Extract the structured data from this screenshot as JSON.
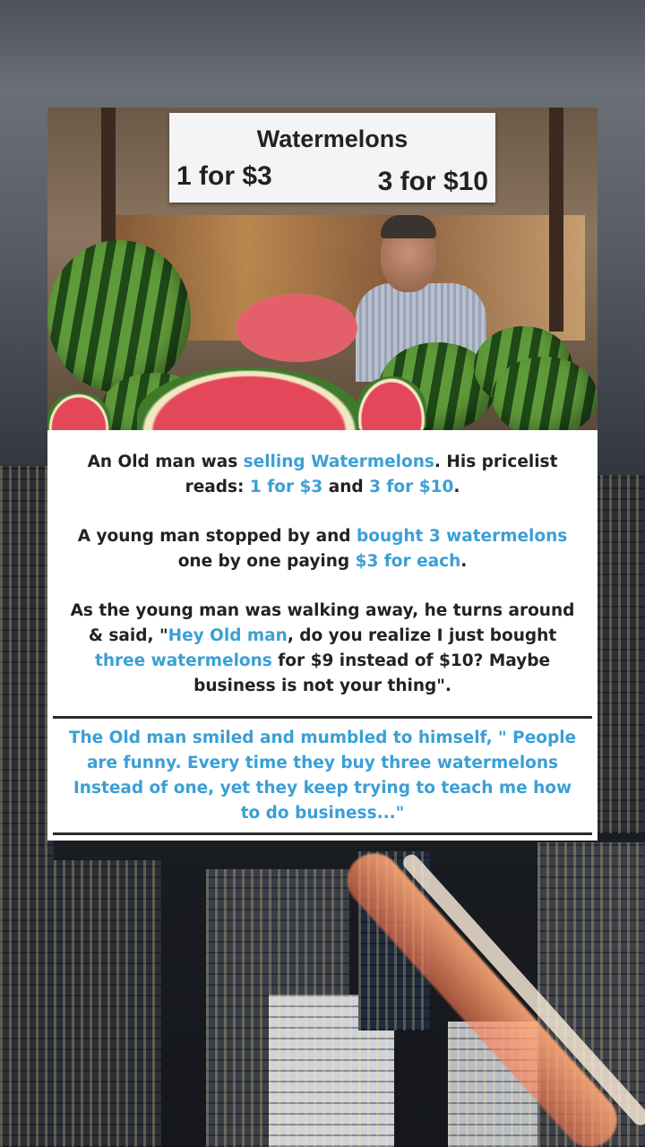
{
  "sign": {
    "title": "Watermelons",
    "left_price": "1 for $3",
    "right_price": "3 for $10"
  },
  "story": {
    "p1": {
      "a": "An Old man was ",
      "b": "selling Watermelons",
      "c": ". His pricelist",
      "d": "reads: ",
      "e": "1 for $3",
      "f": " and ",
      "g": "3 for $10",
      "h": "."
    },
    "p2": {
      "a": "A young man stopped by and ",
      "b": "bought 3 watermelons",
      "c": "one by one paying ",
      "d": "$3 for each",
      "e": "."
    },
    "p3": {
      "a": "As the young man was walking away, he turns around",
      "b": "& said, \"",
      "c": "Hey Old man",
      "d": ", do you realize I just bought",
      "e": "three watermelons",
      "f": " for $9 instead of $10? Maybe",
      "g": "business is not your thing\"."
    },
    "quote": {
      "l1": "The Old man smiled and mumbled to himself, \" People",
      "l2": "are funny. Every time they buy three watermelons",
      "l3": "Instead of one, yet they keep trying to teach me how",
      "l4": "to do business...\""
    }
  },
  "colors": {
    "highlight": "#3b9fd6",
    "text": "#222222",
    "card": "#ffffff"
  }
}
